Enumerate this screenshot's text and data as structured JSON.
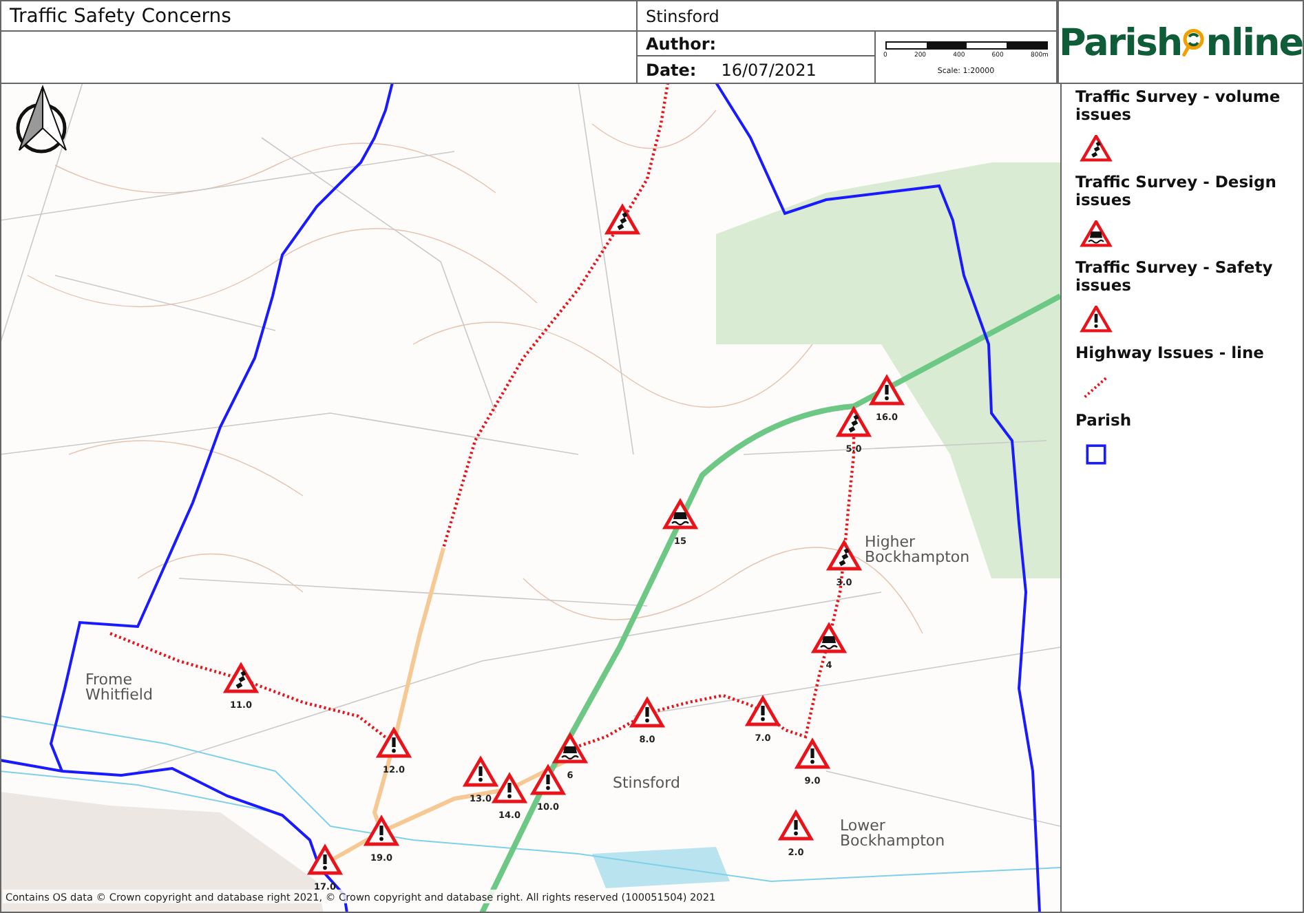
{
  "header": {
    "title": "Traffic Safety Concerns",
    "parish": "Stinsford",
    "author_label": "Author:",
    "date_label": "Date:",
    "date": "16/07/2021",
    "scale": {
      "ticks": [
        "0",
        "200",
        "400",
        "600",
        "800m"
      ],
      "text": "Scale: 1:20000"
    },
    "logo": {
      "left": "Parish",
      "right": "nline"
    }
  },
  "legend": [
    {
      "kind": "volume",
      "label": "Traffic Survey - volume issues"
    },
    {
      "kind": "design",
      "label": "Traffic Survey - Design issues"
    },
    {
      "kind": "safety",
      "label": "Traffic Survey - Safety issues"
    },
    {
      "kind": "line",
      "label": "Highway Issues - line"
    },
    {
      "kind": "parish",
      "label": "Parish"
    }
  ],
  "map": {
    "places": [
      {
        "lines": [
          "Frome",
          "Whitfield"
        ]
      },
      {
        "lines": [
          "Stinsford"
        ]
      },
      {
        "lines": [
          "Higher",
          "Bockhampton"
        ]
      },
      {
        "lines": [
          "Lower",
          "Bockhampton"
        ]
      }
    ],
    "markers": [
      {
        "kind": "volume"
      },
      {
        "kind": "volume",
        "label": "11.0"
      },
      {
        "kind": "safety",
        "label": "12.0"
      },
      {
        "kind": "safety",
        "label": "13.0"
      },
      {
        "kind": "safety",
        "label": "14.0"
      },
      {
        "kind": "safety",
        "label": "10.0"
      },
      {
        "kind": "design",
        "label": "6"
      },
      {
        "kind": "safety",
        "label": "8.0"
      },
      {
        "kind": "safety",
        "label": "7.0"
      },
      {
        "kind": "safety",
        "label": "9.0"
      },
      {
        "kind": "safety",
        "label": "2.0"
      },
      {
        "kind": "safety",
        "label": "19.0"
      },
      {
        "kind": "safety",
        "label": "17.0"
      },
      {
        "kind": "design",
        "label": "15"
      },
      {
        "kind": "safety",
        "label": "16.0"
      },
      {
        "kind": "volume",
        "label": "5.0"
      },
      {
        "kind": "volume",
        "label": "3.0"
      },
      {
        "kind": "design",
        "label": "4"
      }
    ],
    "copyright": "Contains OS data © Crown copyright and database right 2021, © Crown copyright and database right. All rights reserved (100051504) 2021"
  }
}
